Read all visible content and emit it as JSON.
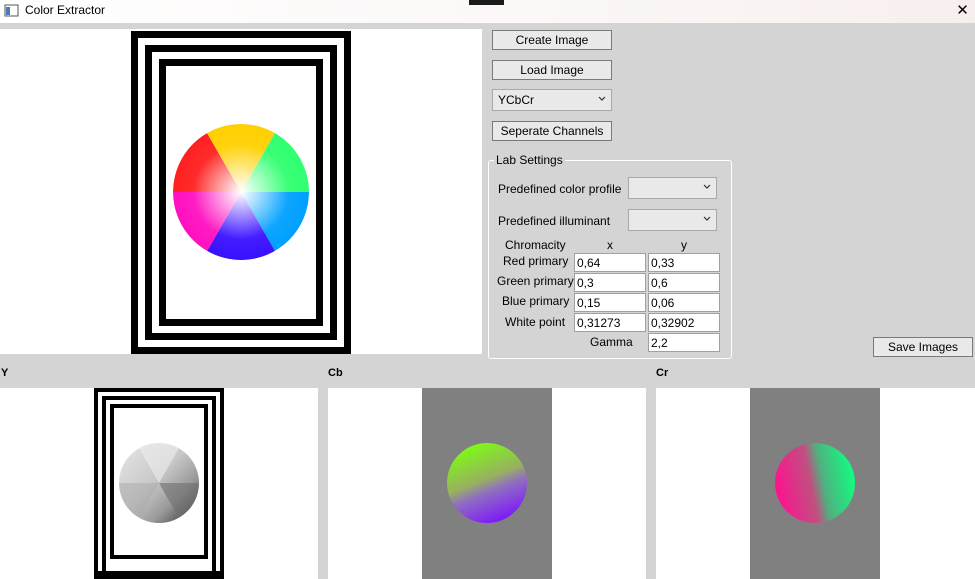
{
  "window": {
    "title": "Color Extractor",
    "close_glyph": "✕",
    "title_bg": "#fbf7f6"
  },
  "buttons": {
    "create_image": "Create Image",
    "load_image": "Load Image",
    "separate_channels": "Seperate Channels",
    "save_images": "Save Images"
  },
  "color_space": {
    "selected": "YCbCr"
  },
  "lab_settings": {
    "title": "Lab Settings",
    "profile_label": "Predefined color profile",
    "profile_value": "",
    "illuminant_label": "Predefined illuminant",
    "illuminant_value": "",
    "chromacity_label": "Chromacity",
    "x_header": "x",
    "y_header": "y",
    "rows": [
      {
        "label": "Red primary",
        "x": "0,64",
        "y": "0,33"
      },
      {
        "label": "Green primary",
        "x": "0,3",
        "y": "0,6"
      },
      {
        "label": "Blue primary",
        "x": "0,15",
        "y": "0,06"
      },
      {
        "label": "White point",
        "x": "0,31273",
        "y": "0,32902"
      }
    ],
    "gamma_label": "Gamma",
    "gamma_value": "2,2"
  },
  "channels": [
    {
      "name": "Y"
    },
    {
      "name": "Cb"
    },
    {
      "name": "Cr"
    }
  ],
  "colors": {
    "form_bg": "#d4d4d4",
    "button_bg": "#e9e9e9",
    "channel_gray": "#808080"
  }
}
